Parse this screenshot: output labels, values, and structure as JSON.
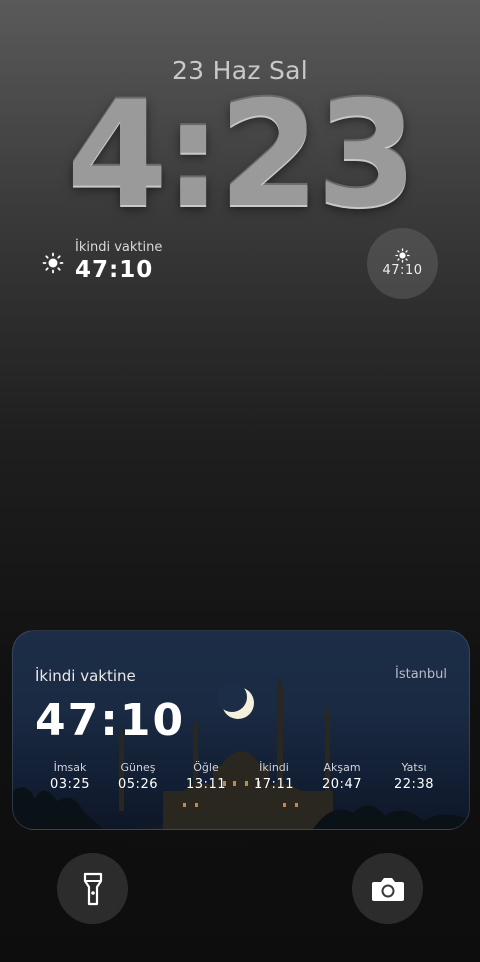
{
  "lockscreen": {
    "date": "23 Haz Sal",
    "time": "4:23"
  },
  "widget_inline": {
    "icon": "sun-icon",
    "label": "İkindi vaktine",
    "value": "47:10"
  },
  "widget_circular": {
    "icon": "sun-icon",
    "value": "47:10"
  },
  "prayer_card": {
    "title": "İkindi vaktine",
    "city": "İstanbul",
    "countdown": "47:10",
    "times": [
      {
        "name": "İmsak",
        "time": "03:25"
      },
      {
        "name": "Güneş",
        "time": "05:26"
      },
      {
        "name": "Öğle",
        "time": "13:11"
      },
      {
        "name": "İkindi",
        "time": "17:11"
      },
      {
        "name": "Akşam",
        "time": "20:47"
      },
      {
        "name": "Yatsı",
        "time": "22:38"
      }
    ]
  },
  "bottom_controls": {
    "left": "flashlight-icon",
    "right": "camera-icon"
  },
  "colors": {
    "clock": "#9a9a9a",
    "card_bg": "#1a2a42"
  }
}
